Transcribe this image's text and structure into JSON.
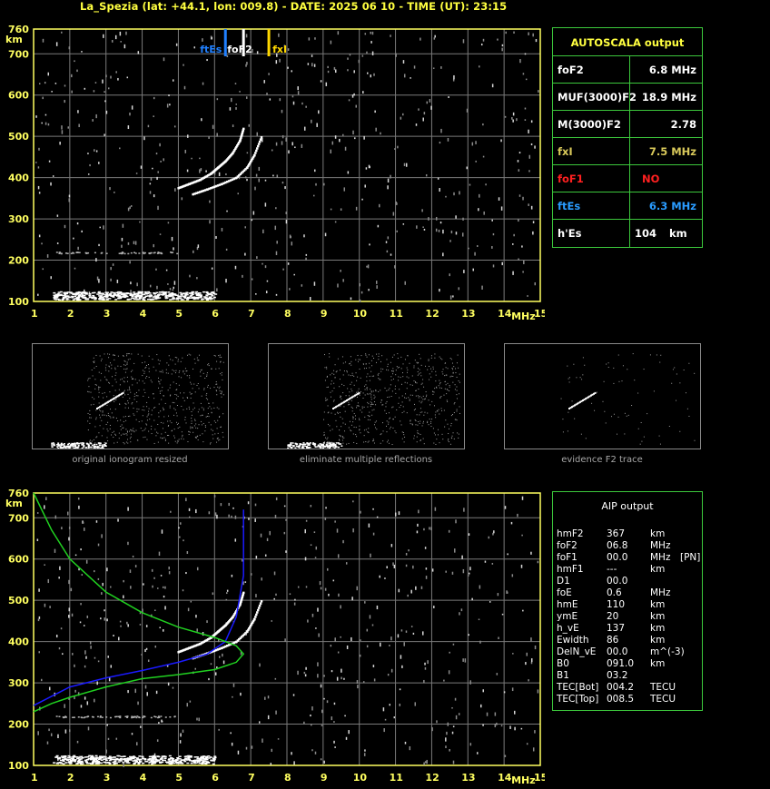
{
  "header": {
    "title": "La_Spezia (lat: +44.1, lon: 009.8) - DATE: 2025 06 10 - TIME (UT): 23:15"
  },
  "colors": {
    "grid": "#7a7a7a",
    "axis_frame": "#ffff60",
    "trace": "#ffffff",
    "foF2_marker": "#ffffff",
    "ftEs_marker": "#2080ff",
    "fxI_marker": "#ffd800",
    "profile_green": "#20d020",
    "profile_blue": "#1a1aff",
    "box_border": "#3cc83c"
  },
  "ionogram_top": {
    "y_unit": "km",
    "x_unit": "MHz",
    "y_ticks": [
      "100",
      "200",
      "300",
      "400",
      "500",
      "600",
      "700",
      "760"
    ],
    "x_ticks": [
      "1",
      "2",
      "3",
      "4",
      "5",
      "6",
      "7",
      "8",
      "9",
      "10",
      "11",
      "12",
      "13",
      "14",
      "15"
    ],
    "markers": [
      {
        "label": "ftEs",
        "freq": 6.3
      },
      {
        "label": "foF2",
        "freq": 6.8
      },
      {
        "label": "fxI",
        "freq": 7.5
      }
    ]
  },
  "autoscala": {
    "title": "AUTOSCALA output",
    "rows": [
      {
        "label": "foF2",
        "value": "6.8 MHz",
        "color": "#ffffff"
      },
      {
        "label": "MUF(3000)F2",
        "value": "18.9 MHz",
        "color": "#ffffff"
      },
      {
        "label": "M(3000)F2",
        "value": "2.78",
        "color": "#ffffff"
      },
      {
        "label": "fxI",
        "value": "7.5 MHz",
        "color": "#d8c85a"
      },
      {
        "label": "foF1",
        "value": "NO",
        "color": "#ff2020"
      },
      {
        "label": "ftEs",
        "value": "6.3 MHz",
        "color": "#2a9cff"
      },
      {
        "label": "h'Es",
        "value": "104",
        "unit": "km",
        "color": "#ffffff"
      }
    ]
  },
  "thumbnails": [
    {
      "caption": "original ionogram resized"
    },
    {
      "caption": "eliminate multiple reflections"
    },
    {
      "caption": "evidence F2 trace"
    }
  ],
  "aip": {
    "title": "AIP output",
    "rows": [
      {
        "label": "hmF2",
        "value": "367",
        "unit": "km",
        "extra": ""
      },
      {
        "label": "foF2",
        "value": "06.8",
        "unit": "MHz",
        "extra": ""
      },
      {
        "label": "foF1",
        "value": "00.0",
        "unit": "MHz",
        "extra": "[PN]"
      },
      {
        "label": "hmF1",
        "value": "---",
        "unit": "km",
        "extra": ""
      },
      {
        "label": "D1",
        "value": "00.0",
        "unit": "",
        "extra": ""
      },
      {
        "label": "foE",
        "value": "0.6",
        "unit": "MHz",
        "extra": ""
      },
      {
        "label": "hmE",
        "value": "110",
        "unit": "km",
        "extra": ""
      },
      {
        "label": "ymE",
        "value": "20",
        "unit": "km",
        "extra": ""
      },
      {
        "label": "h_vE",
        "value": "137",
        "unit": "km",
        "extra": ""
      },
      {
        "label": "Ewidth",
        "value": "86",
        "unit": "km",
        "extra": ""
      },
      {
        "label": "DelN_vE",
        "value": "00.0",
        "unit": "m^(-3)",
        "extra": ""
      },
      {
        "label": "B0",
        "value": "091.0",
        "unit": "km",
        "extra": ""
      },
      {
        "label": "B1",
        "value": "03.2",
        "unit": "",
        "extra": ""
      },
      {
        "label": "TEC[Bot]",
        "value": "004.2",
        "unit": "TECU",
        "extra": ""
      },
      {
        "label": "TEC[Top]",
        "value": "008.5",
        "unit": "TECU",
        "extra": ""
      }
    ]
  },
  "chart_data": [
    {
      "type": "scatter",
      "title": "",
      "xlabel": "MHz",
      "ylabel": "km",
      "xlim": [
        1,
        15
      ],
      "ylim": [
        100,
        760
      ],
      "grid": true,
      "series": [
        {
          "values_x": [
            5.0,
            5.3,
            5.6,
            5.9,
            6.1,
            6.3,
            6.5,
            6.7,
            6.8
          ],
          "values_y": [
            375,
            385,
            395,
            410,
            425,
            440,
            460,
            490,
            520
          ]
        },
        {
          "values_x": [
            5.4,
            5.8,
            6.2,
            6.6,
            6.9,
            7.1,
            7.3
          ],
          "values_y": [
            360,
            372,
            385,
            400,
            425,
            455,
            500
          ]
        },
        {
          "values_x": [
            1.5,
            2,
            2.5,
            3,
            3.5,
            4,
            4.5,
            5,
            5.5,
            6.0
          ],
          "values_y": [
            115,
            118,
            120,
            122,
            120,
            118,
            116,
            114,
            114,
            114
          ]
        }
      ]
    },
    {
      "type": "line",
      "title": "",
      "xlabel": "MHz",
      "ylabel": "km",
      "xlim": [
        1,
        15
      ],
      "ylim": [
        100,
        760
      ],
      "grid": true,
      "series": [
        {
          "values_x": [
            1.0,
            2.0,
            3.0,
            4.0,
            5.0,
            5.8,
            6.3,
            6.6,
            6.8,
            6.8
          ],
          "values_y": [
            245,
            290,
            312,
            330,
            350,
            370,
            400,
            460,
            560,
            720
          ]
        },
        {
          "values_x": [
            1.0,
            1.5,
            2.0,
            3.0,
            4.0,
            5.0,
            6.0,
            6.6,
            6.8,
            6.6,
            6.0,
            5.0,
            4.0,
            3.0,
            2.0,
            1.5,
            1.0
          ],
          "values_y": [
            230,
            250,
            265,
            290,
            310,
            320,
            332,
            350,
            370,
            390,
            410,
            435,
            470,
            520,
            600,
            670,
            760
          ]
        }
      ]
    }
  ]
}
